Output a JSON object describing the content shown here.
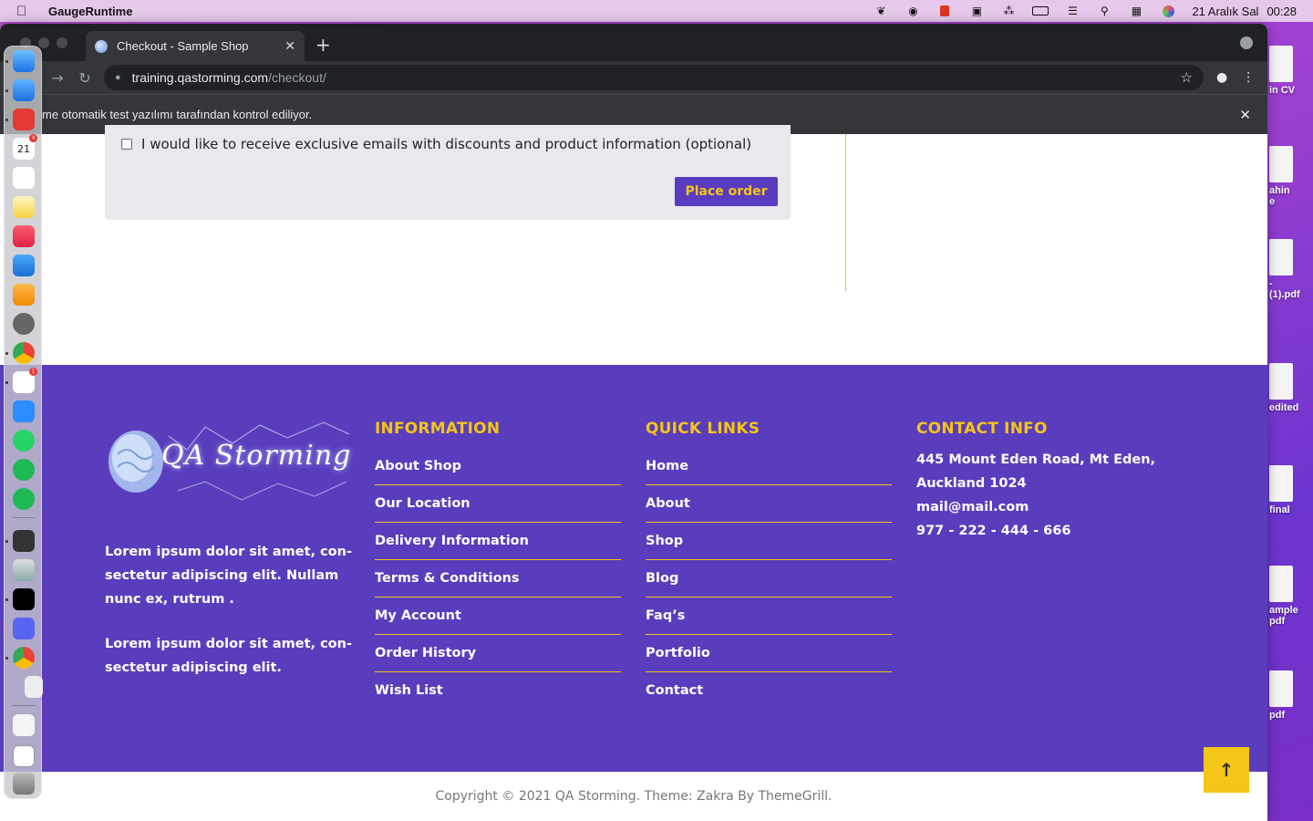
{
  "menubar": {
    "app_name": "GaugeRuntime",
    "date": "21 Aralık Sal",
    "time": "00:28",
    "icons": [
      "feather-icon",
      "notification-app-icon",
      "red-app-icon",
      "car-icon",
      "bluetooth-icon",
      "battery-icon",
      "wifi-icon",
      "spotlight-search-icon",
      "control-center-icon",
      "siri-icon"
    ]
  },
  "browser": {
    "tab_title": "Checkout - Sample Shop",
    "url_host": "training.qastorming.com",
    "url_path": "/checkout/",
    "infobar_text": "me otomatik test yazılımı tarafından kontrol ediliyor."
  },
  "checkout": {
    "optin_label": "I would like to receive exclusive emails with discounts and product information (optional)",
    "place_order_label": "Place order"
  },
  "footer": {
    "logo_text": "QA Storming",
    "about_paragraphs": [
      "Lorem ipsum dolor sit amet, con-sectetur adipiscing elit. Nullam nunc ex, rutrum .",
      "Lorem ipsum dolor sit amet, con-sectetur adipiscing elit."
    ],
    "information": {
      "heading": "INFORMATION",
      "links": [
        "About Shop",
        "Our Location",
        "Delivery Information",
        "Terms & Conditions",
        "My Account",
        "Order History",
        "Wish List"
      ]
    },
    "quick_links": {
      "heading": "QUICK LINKS",
      "links": [
        "Home",
        "About",
        "Shop",
        "Blog",
        "Faq’s",
        "Portfolio",
        "Contact"
      ]
    },
    "contact": {
      "heading": "CONTACT INFO",
      "address_line1": "445 Mount Eden Road, Mt Eden,",
      "address_line2": "Auckland 1024",
      "email": "mail@mail.com",
      "phone": "977 - 222 - 444 - 666"
    },
    "copyright": "Copyright © 2021 QA Storming. Theme: Zakra By ThemeGrill."
  },
  "desktop_files": [
    "in CV",
    "ahin\ne",
    "-\n(1).pdf",
    "edited",
    "final",
    "ample\npdf",
    "pdf"
  ],
  "dock_badges": {
    "calendar_day": "21",
    "calendar_badge": "4",
    "slack_badge": "1"
  },
  "colors": {
    "brand_purple": "#5a3dbd",
    "accent_yellow": "#f5c518",
    "button_purple": "#5a3cc0"
  }
}
